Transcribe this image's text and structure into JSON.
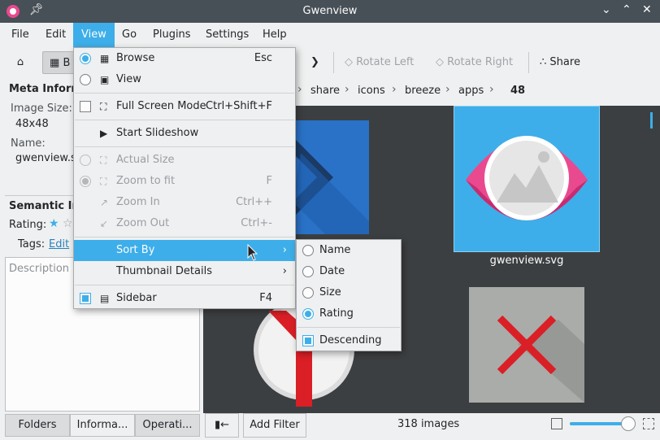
{
  "window": {
    "title": "Gwenview"
  },
  "colors": {
    "accent": "#3daee9",
    "titlebar": "#475057",
    "viewer_bg": "#3c3f41",
    "gwenview_pink": "#e94a8f"
  },
  "menubar": [
    "File",
    "Edit",
    "View",
    "Go",
    "Plugins",
    "Settings",
    "Help"
  ],
  "toolbar": {
    "browse_label": "B",
    "rotate_left": "Rotate Left",
    "rotate_right": "Rotate Right",
    "share": "Share"
  },
  "sidebar": {
    "meta_heading": "Meta Informa",
    "image_size_label": "Image Size:",
    "image_size_value": "48x48",
    "name_label": "Name:",
    "name_value": "gwenview.sv",
    "semantic_heading": "Semantic Info",
    "rating_label": "Rating:",
    "tags_label": "Tags:",
    "tags_link": "Edit",
    "description_placeholder": "Description",
    "tabs": [
      "Folders",
      "Informa...",
      "Operati..."
    ]
  },
  "breadcrumb": [
    "share",
    "icons",
    "breeze",
    "apps",
    "48"
  ],
  "thumbnails": {
    "selected_caption": "gwenview.svg"
  },
  "statusbar": {
    "back_button": "▮←",
    "add_filter": "Add Filter",
    "count": "318 images",
    "zoom_level": 0.9
  },
  "view_menu": {
    "items": [
      {
        "label": "Browse",
        "shortcut": "Esc"
      },
      {
        "label": "View",
        "shortcut": ""
      },
      {
        "label": "Full Screen Mode",
        "shortcut": "Ctrl+Shift+F"
      },
      {
        "label": "Start Slideshow",
        "shortcut": ""
      },
      {
        "label": "Actual Size",
        "shortcut": ""
      },
      {
        "label": "Zoom to fit",
        "shortcut": "F"
      },
      {
        "label": "Zoom In",
        "shortcut": "Ctrl++"
      },
      {
        "label": "Zoom Out",
        "shortcut": "Ctrl+-"
      },
      {
        "label": "Sort By",
        "shortcut": ""
      },
      {
        "label": "Thumbnail Details",
        "shortcut": ""
      },
      {
        "label": "Sidebar",
        "shortcut": "F4"
      }
    ]
  },
  "sort_menu": {
    "items": [
      "Name",
      "Date",
      "Size",
      "Rating",
      "Descending"
    ],
    "selected": "Rating"
  }
}
